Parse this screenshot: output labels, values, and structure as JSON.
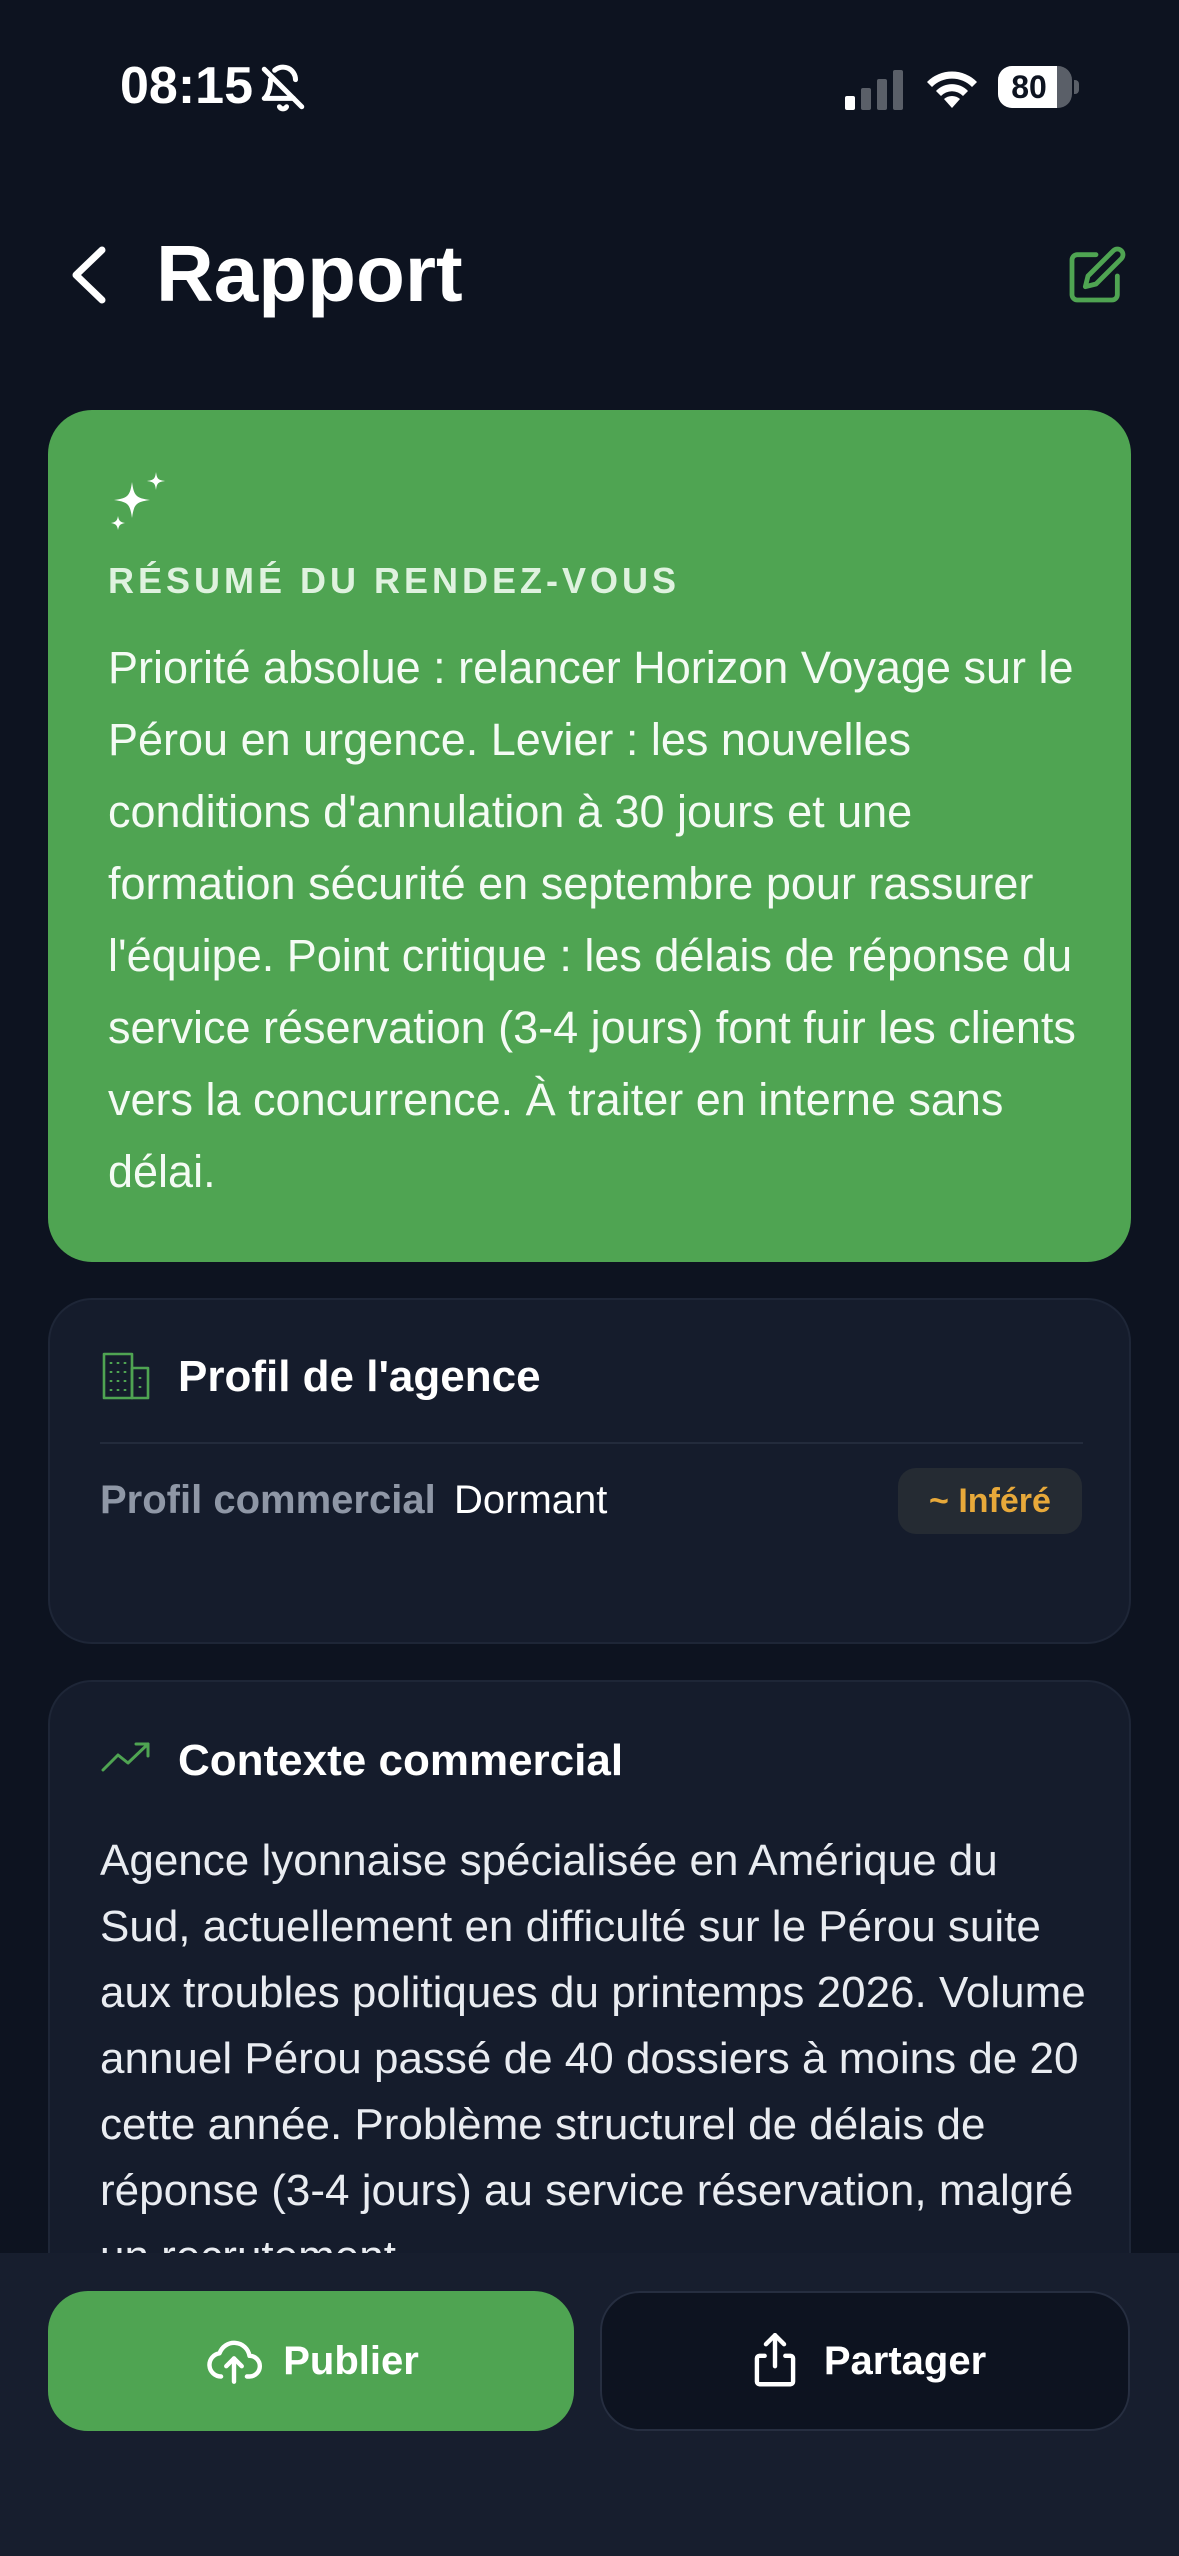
{
  "status_bar": {
    "time": "08:15",
    "battery": "80",
    "battery_level": 0.8
  },
  "header": {
    "title": "Rapport",
    "back_icon": "chevron-left-icon",
    "edit_icon": "edit-icon"
  },
  "summary": {
    "label": "RÉSUMÉ DU RENDEZ-VOUS",
    "text": "Priorité absolue : relancer Horizon Voyage sur le Pérou en urgence. Levier : les nouvelles conditions d'annulation à 30 jours et une formation sécurité en septembre pour rassurer l'équipe. Point critique : les délais de réponse du service réservation (3-4 jours) font fuir les clients vers la concurrence. À traiter en interne sans délai.",
    "icon": "sparkles-icon"
  },
  "profile": {
    "title": "Profil de l'agence",
    "icon": "building-icon",
    "field_label": "Profil commercial",
    "field_value": "Dormant",
    "badge": "~ Inféré"
  },
  "context": {
    "title": "Contexte commercial",
    "icon": "trending-up-icon",
    "text": "Agence lyonnaise spécialisée en Amérique du Sud, actuellement en difficulté sur le Pérou suite aux troubles politiques du printemps 2026. Volume annuel Pérou passé de 40 dossiers à moins de 20 cette année. Problème structurel de délais de réponse (3-4 jours) au service réservation, malgré un recrutement"
  },
  "actions": {
    "publish_label": "Publier",
    "share_label": "Partager"
  },
  "colors": {
    "background": "#0d1320",
    "accent_green": "#4fa452",
    "card": "#151c2c",
    "badge_text": "#e8a93a"
  }
}
